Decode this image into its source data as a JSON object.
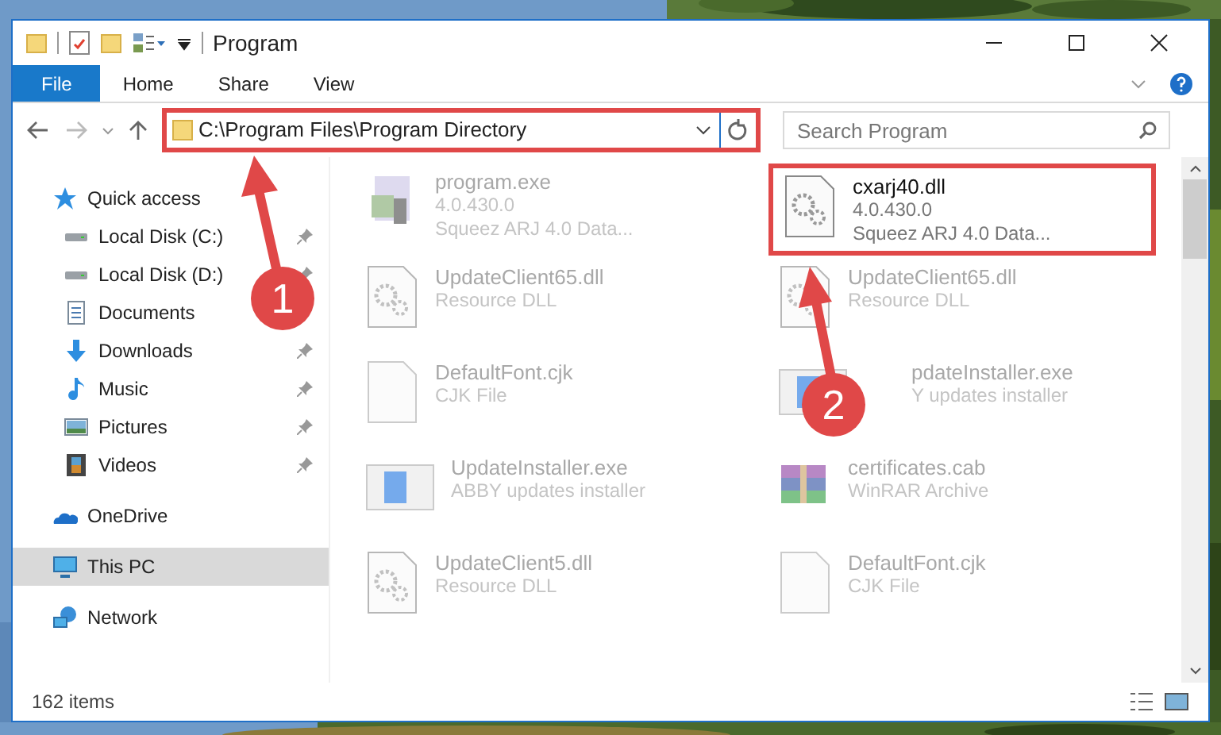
{
  "window": {
    "title": "Program"
  },
  "ribbon_tabs": [
    {
      "label": "File",
      "selected": true
    },
    {
      "label": "Home",
      "selected": false
    },
    {
      "label": "Share",
      "selected": false
    },
    {
      "label": "View",
      "selected": false
    }
  ],
  "address": {
    "path": "C:\\Program Files\\Program Directory",
    "highlighted": true
  },
  "search": {
    "placeholder": "Search Program"
  },
  "sidebar": {
    "items": [
      {
        "label": "Quick access",
        "kind": "quick",
        "selected": false,
        "children": [
          {
            "label": "Local Disk (C:)",
            "kind": "drive",
            "pinned": true,
            "selected": false
          },
          {
            "label": "Local Disk (D:)",
            "kind": "drive",
            "pinned": true,
            "selected": false
          },
          {
            "label": "Documents",
            "kind": "documents",
            "selected": false
          },
          {
            "label": "Downloads",
            "kind": "downloads",
            "pinned": true,
            "selected": false
          },
          {
            "label": "Music",
            "kind": "music",
            "pinned": true,
            "selected": false
          },
          {
            "label": "Pictures",
            "kind": "pictures",
            "pinned": true,
            "selected": false
          },
          {
            "label": "Videos",
            "kind": "videos",
            "pinned": true,
            "selected": false
          }
        ]
      },
      {
        "label": "OneDrive",
        "kind": "cloud",
        "selected": false
      },
      {
        "label": "This PC",
        "kind": "pc",
        "selected": true
      },
      {
        "label": "Network",
        "kind": "network",
        "selected": false
      }
    ]
  },
  "files": [
    {
      "name": "program.exe",
      "details": [
        "4.0.430.0",
        "Squeez ARJ 4.0 Data..."
      ],
      "kind": "app",
      "blurred": true,
      "highlighted": false
    },
    {
      "name": "cxarj40.dll",
      "details": [
        "4.0.430.0",
        "Squeez ARJ 4.0 Data..."
      ],
      "kind": "dll",
      "blurred": false,
      "highlighted": true
    },
    {
      "name": "UpdateClient65.dll",
      "details": [
        "Resource DLL"
      ],
      "kind": "dll",
      "blurred": true,
      "highlighted": false
    },
    {
      "name": "UpdateClient65.dll",
      "details": [
        "Resource DLL"
      ],
      "kind": "dll",
      "blurred": true,
      "highlighted": false
    },
    {
      "name": "DefaultFont.cjk",
      "details": [
        "CJK File"
      ],
      "kind": "blank",
      "blurred": true,
      "highlighted": false
    },
    {
      "name": "pdateInstaller.exe",
      "details": [
        "Y updates installer"
      ],
      "kind": "installer",
      "blurred": true,
      "highlighted": false,
      "covered": true
    },
    {
      "name": "UpdateInstaller.exe",
      "details": [
        "ABBY updates installer"
      ],
      "kind": "installer",
      "blurred": true,
      "highlighted": false
    },
    {
      "name": "certificates.cab",
      "details": [
        "WinRAR Archive"
      ],
      "kind": "archive",
      "blurred": true,
      "highlighted": false
    },
    {
      "name": "UpdateClient5.dll",
      "details": [
        "Resource DLL"
      ],
      "kind": "dll",
      "blurred": true,
      "highlighted": false
    },
    {
      "name": "DefaultFont.cjk",
      "details": [
        "CJK File"
      ],
      "kind": "blank",
      "blurred": true,
      "highlighted": false
    }
  ],
  "status_bar": {
    "count": "162 items"
  },
  "annotations": [
    {
      "label": "1"
    },
    {
      "label": "2"
    }
  ]
}
